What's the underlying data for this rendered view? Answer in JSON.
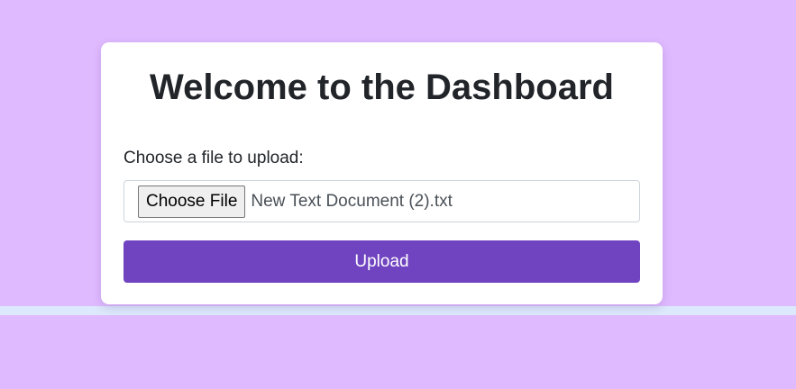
{
  "dashboard": {
    "title": "Welcome to the Dashboard",
    "file_label": "Choose a file to upload:",
    "file_input": {
      "button_label": "Choose File",
      "selected_file": "New Text Document (2).txt"
    },
    "upload_label": "Upload"
  },
  "colors": {
    "background": "#e0baff",
    "card": "#ffffff",
    "accent": "#7044c0"
  }
}
